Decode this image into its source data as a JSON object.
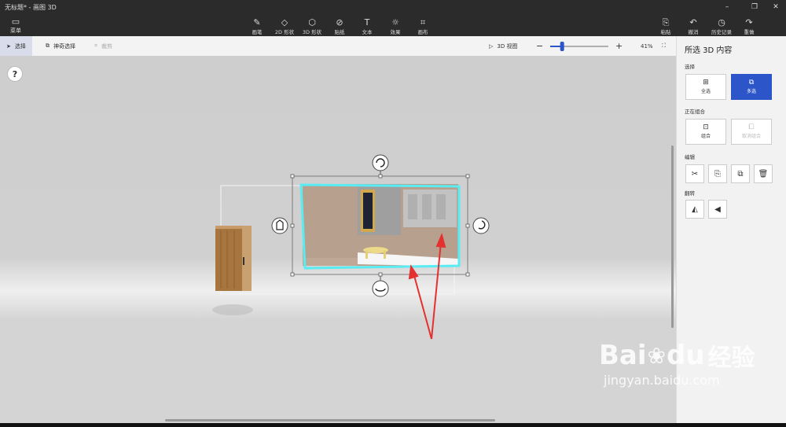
{
  "window": {
    "title": "无标题* - 画图 3D"
  },
  "menu": {
    "label": "菜单"
  },
  "tools": [
    {
      "label": "画笔"
    },
    {
      "label": "2D 形状"
    },
    {
      "label": "3D 形状"
    },
    {
      "label": "贴纸"
    },
    {
      "label": "文本"
    },
    {
      "label": "效果"
    },
    {
      "label": "画布"
    }
  ],
  "right_tools": [
    {
      "label": "粘贴"
    },
    {
      "label": "撤消"
    },
    {
      "label": "历史记录"
    },
    {
      "label": "重做"
    }
  ],
  "subbar": {
    "select": "选择",
    "magic_select": "神奇选择",
    "crop": "裁剪",
    "view_3d": "3D 视图",
    "zoom": "41%",
    "zoom_level": 0.41
  },
  "help": "?",
  "panel": {
    "title": "所选 3D 内容",
    "select_section": "选择",
    "select_all": "全选",
    "multi_select": "多选",
    "group_section": "正在组合",
    "group": "组合",
    "ungroup": "取消组合",
    "edit_section": "编辑",
    "flip_section": "翻转"
  },
  "watermark": {
    "brand": "Bai",
    "brand_after": "du",
    "cn": "经验",
    "url": "jingyan.baidu.com"
  }
}
